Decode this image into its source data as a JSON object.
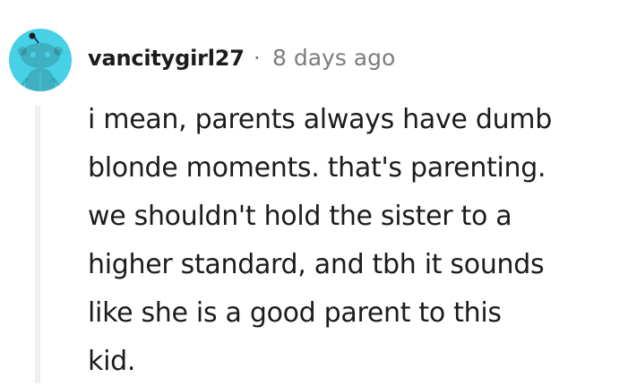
{
  "comment": {
    "author": "vancitygirl27",
    "separator": "·",
    "timestamp": "8 days ago",
    "avatar_icon": "snoo-avatar-icon",
    "avatar_bg": "#46d1e6",
    "body_lines": [
      "i mean, parents always have dumb",
      "blonde moments. that's parenting.",
      "we shouldn't hold the sister to a",
      "higher standard, and tbh it sounds",
      "like she is a good parent to this",
      "kid."
    ]
  }
}
